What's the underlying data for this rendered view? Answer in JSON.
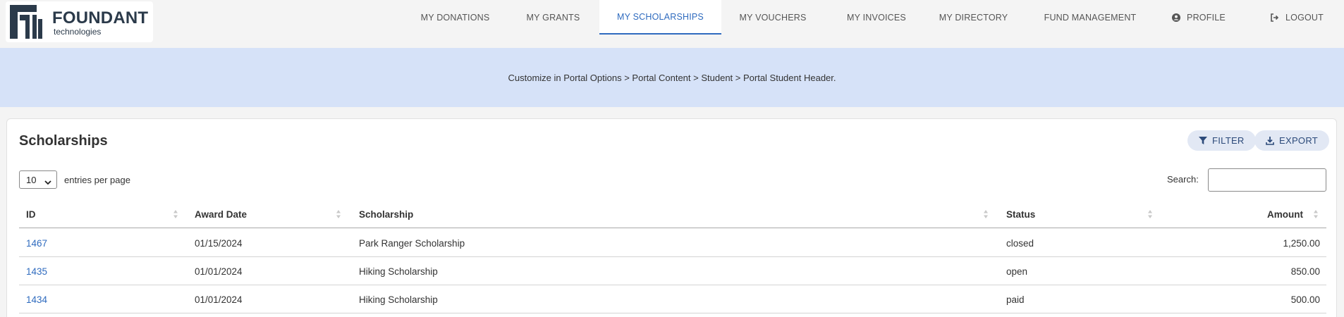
{
  "brand": {
    "name": "FOUNDANT",
    "sub": "technologies"
  },
  "nav": {
    "items": [
      {
        "label": "MY DONATIONS"
      },
      {
        "label": "MY GRANTS"
      },
      {
        "label": "MY SCHOLARSHIPS",
        "active": true
      },
      {
        "label": "MY VOUCHERS"
      },
      {
        "label": "MY INVOICES"
      },
      {
        "label": "MY DIRECTORY"
      },
      {
        "label": "FUND MANAGEMENT"
      },
      {
        "label": "PROFILE",
        "icon": "user-circle-icon"
      },
      {
        "label": "LOGOUT",
        "icon": "logout-icon"
      }
    ]
  },
  "banner": {
    "text": "Customize in Portal Options > Portal Content > Student > Portal Student Header."
  },
  "card": {
    "title": "Scholarships",
    "filter_label": "FILTER",
    "export_label": "EXPORT",
    "entries_value": "10",
    "entries_label": "entries per page",
    "search_label": "Search:",
    "search_value": ""
  },
  "table": {
    "columns": [
      "ID",
      "Award Date",
      "Scholarship",
      "Status",
      "Amount"
    ],
    "rows": [
      {
        "id": "1467",
        "date": "01/15/2024",
        "scholarship": "Park Ranger Scholarship",
        "status": "closed",
        "amount": "1,250.00"
      },
      {
        "id": "1435",
        "date": "01/01/2024",
        "scholarship": "Hiking Scholarship",
        "status": "open",
        "amount": "850.00"
      },
      {
        "id": "1434",
        "date": "01/01/2024",
        "scholarship": "Hiking Scholarship",
        "status": "paid",
        "amount": "500.00"
      }
    ]
  },
  "colors": {
    "accent": "#2f6bbf",
    "banner": "#d6e2f8",
    "pill": "#e2e8f4"
  }
}
